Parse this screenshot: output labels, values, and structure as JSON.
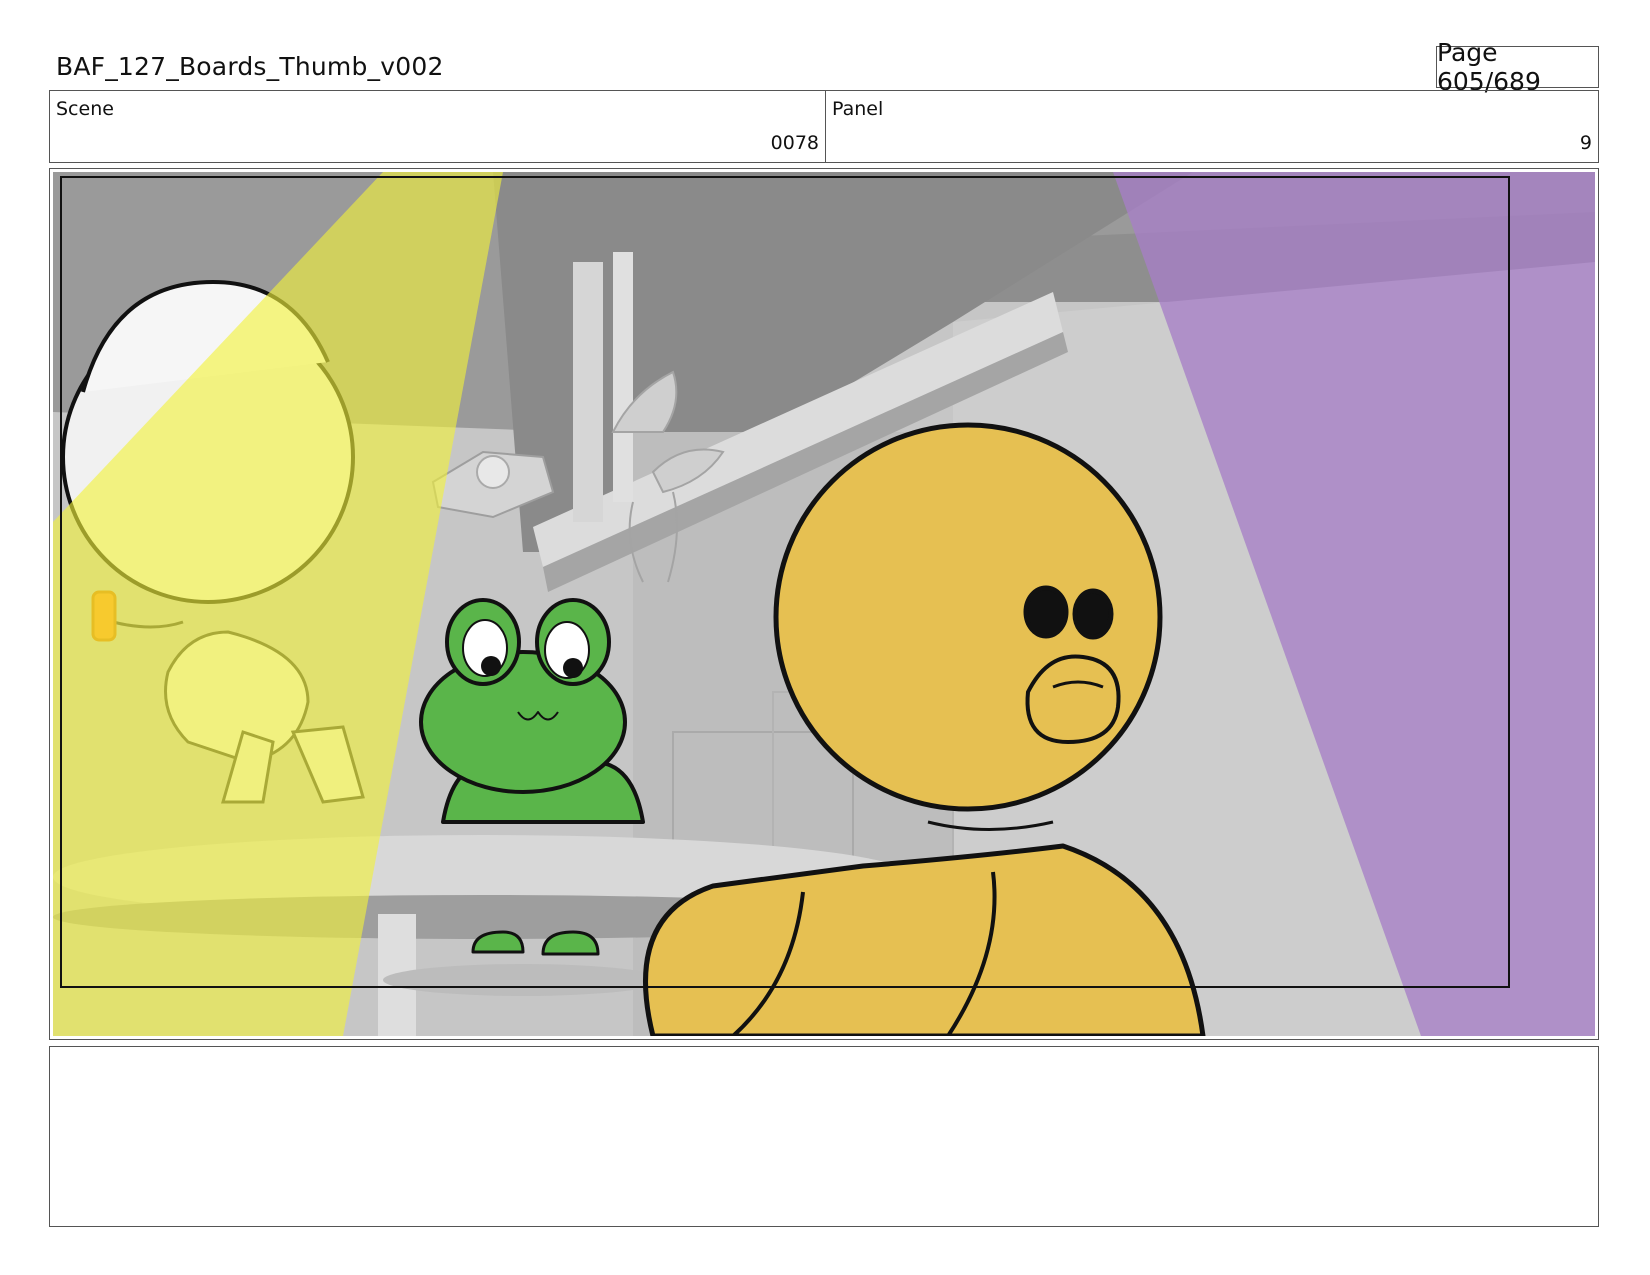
{
  "header": {
    "doc_title": "BAF_127_Boards_Thumb_v002",
    "page_indicator": "Page 605/689"
  },
  "info": {
    "scene_label": "Scene",
    "scene_value": "0078",
    "panel_label": "Panel",
    "panel_value": "9"
  },
  "notes": {
    "text": ""
  },
  "colors": {
    "light_yellow": "#eeee66",
    "light_purple": "#b497c9",
    "frog_green": "#5ab54a",
    "duck_yellow": "#e6c052",
    "set_gray": "#c9c9c9"
  }
}
